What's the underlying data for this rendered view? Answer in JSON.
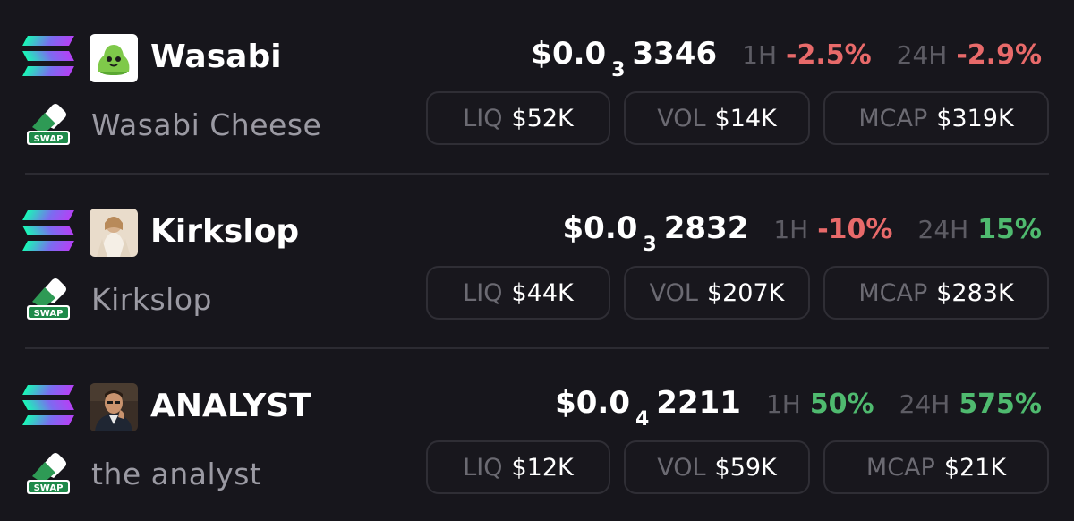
{
  "tokens": [
    {
      "symbol": "Wasabi",
      "name": "Wasabi Cheese",
      "price_prefix": "$0.0",
      "price_zeros": "3",
      "price_digits": "3346",
      "tf1_label": "1H",
      "tf1_value": "-2.5%",
      "tf2_label": "24H",
      "tf2_value": "-2.9%",
      "liq_label": "LIQ",
      "liq_value": "$52K",
      "vol_label": "VOL",
      "vol_value": "$14K",
      "mcap_label": "MCAP",
      "mcap_value": "$319K",
      "avatar": "green-slime-icon"
    },
    {
      "symbol": "Kirkslop",
      "name": "Kirkslop",
      "price_prefix": "$0.0",
      "price_zeros": "3",
      "price_digits": "2832",
      "tf1_label": "1H",
      "tf1_value": "-10%",
      "tf2_label": "24H",
      "tf2_value": "15%",
      "liq_label": "LIQ",
      "liq_value": "$44K",
      "vol_label": "VOL",
      "vol_value": "$207K",
      "mcap_label": "MCAP",
      "mcap_value": "$283K",
      "avatar": "robed-figure-icon"
    },
    {
      "symbol": "ANALYST",
      "name": "the analyst",
      "price_prefix": "$0.0",
      "price_zeros": "4",
      "price_digits": "2211",
      "tf1_label": "1H",
      "tf1_value": "50%",
      "tf2_label": "24H",
      "tf2_value": "575%",
      "liq_label": "LIQ",
      "liq_value": "$12K",
      "vol_label": "VOL",
      "vol_value": "$59K",
      "mcap_label": "MCAP",
      "mcap_value": "$21K",
      "avatar": "man-portrait-icon"
    }
  ],
  "swap_badge_text": "SWAP",
  "colors": {
    "background": "#17161c",
    "negative": "#e86a6a",
    "positive": "#4fba6f",
    "muted": "#9b9aa3",
    "border": "#2f2e35"
  },
  "icons": {
    "chain": "solana-icon",
    "swap": "swap-eraser-icon"
  }
}
